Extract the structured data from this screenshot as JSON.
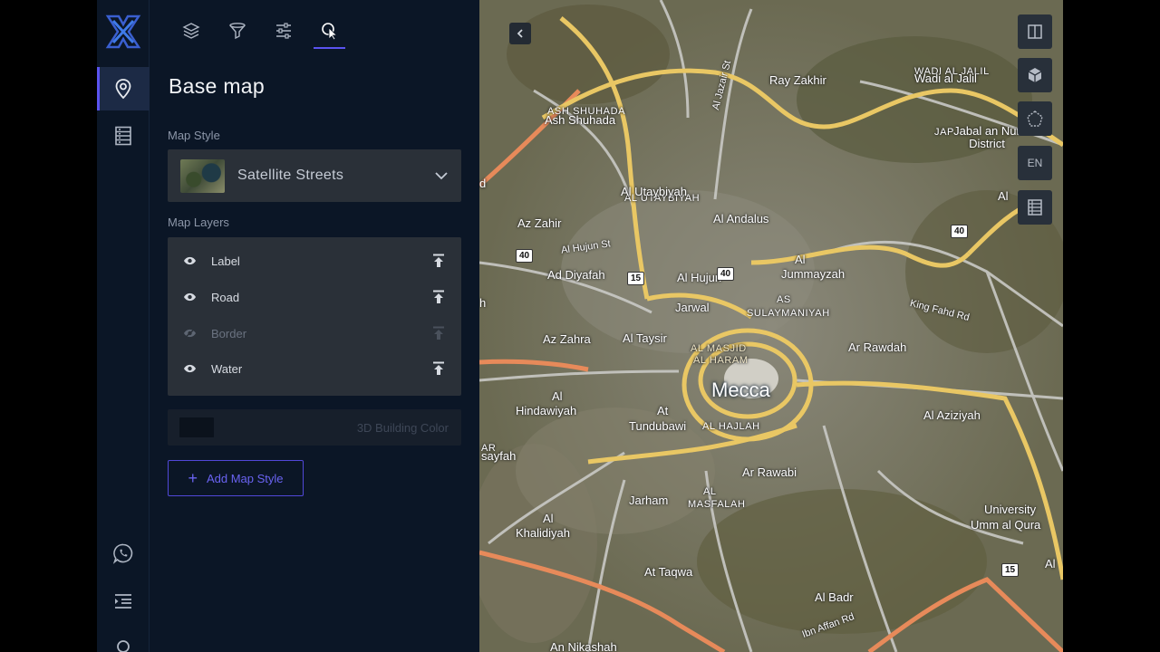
{
  "rail": {
    "items": [
      {
        "name": "map-pin-icon",
        "active": true
      },
      {
        "name": "database-icon",
        "active": false
      }
    ],
    "bottom": [
      "whatsapp-icon",
      "menu-indent-icon",
      "user-icon"
    ]
  },
  "panel": {
    "tabs": [
      "layers-icon",
      "filter-icon",
      "sliders-icon",
      "interaction-icon"
    ],
    "active_tab": "interaction-icon",
    "title": "Base map",
    "map_style_label": "Map Style",
    "selected_style": "Satellite Streets",
    "map_layers_label": "Map Layers",
    "layers": [
      {
        "label": "Label",
        "visible": true
      },
      {
        "label": "Road",
        "visible": true
      },
      {
        "label": "Border",
        "visible": false
      },
      {
        "label": "Water",
        "visible": true
      }
    ],
    "building_color_label": "3D Building Color",
    "add_style_label": "Add Map Style"
  },
  "map": {
    "language": "EN",
    "city": "Mecca",
    "labels": {
      "ray_zakhir": "Ray Zakhir",
      "wadi_al_jalil": "Wadi al Jalil",
      "wadi_al_jalil_small": "WADI AL JALIL",
      "jabal_an_nur": "Jabal an Nur District",
      "jap": "JAP",
      "ash_shuhada": "Ash Shuhada",
      "ash_shuhada_small": "ASH SHUHADA",
      "al_jazair": "Al Jazair St",
      "al_utaybiyah": "Al Utaybiyah",
      "al_utaybiyah_small": "AL UTAYBIYAH",
      "al_andalus": "Al Andalus",
      "az_zahir": "Az Zahir",
      "al_hujun_st": "Al Hujun St",
      "ad_diyafah": "Ad Diyafah",
      "al_hujun": "Al Hujun",
      "al_jummayzah_1": "Al",
      "al_jummayzah_2": "Jummayzah",
      "as_sulaymaniyah_1": "AS",
      "as_sulaymaniyah_2": "SULAYMANIYAH",
      "jarwal": "Jarwal",
      "king_fahd_rd": "King Fahd Rd",
      "ar_rawdah": "Ar Rawdah",
      "az_zahra": "Az Zahra",
      "al_taysir": "Al Taysir",
      "al_masjid_1": "AL MASJID",
      "al_masjid_2": "AL HARAM",
      "al_hindawiyah_1": "Al",
      "al_hindawiyah_2": "Hindawiyah",
      "at_tundubawi_1": "At",
      "at_tundubawi_2": "Tundubawi",
      "al_hajlah": "AL HAJLAH",
      "al_aziziyah": "Al Aziziyah",
      "sayfah_1": "AR",
      "sayfah_2": "sayfah",
      "ar_rawabi": "Ar Rawabi",
      "jarham": "Jarham",
      "al_masfalah_1": "AL",
      "al_masfalah_2": "MASFALAH",
      "al_khalidiyah_1": "Al",
      "al_khalidiyah_2": "Khalidiyah",
      "university_1": "University",
      "university_2": "Umm al Qura",
      "at_taqwa": "At Taqwa",
      "al_badr": "Al Badr",
      "ibn_affan_rd": "Ibn Affan Rd",
      "an_nikashah": "An Nikashah",
      "al_edge": "Al",
      "al_edge2": "Al",
      "d_edge": "d",
      "h_edge": "h"
    },
    "shields": {
      "s40a": "40",
      "s15a": "15",
      "s40b": "40",
      "s40c": "40",
      "s15b": "15"
    }
  }
}
